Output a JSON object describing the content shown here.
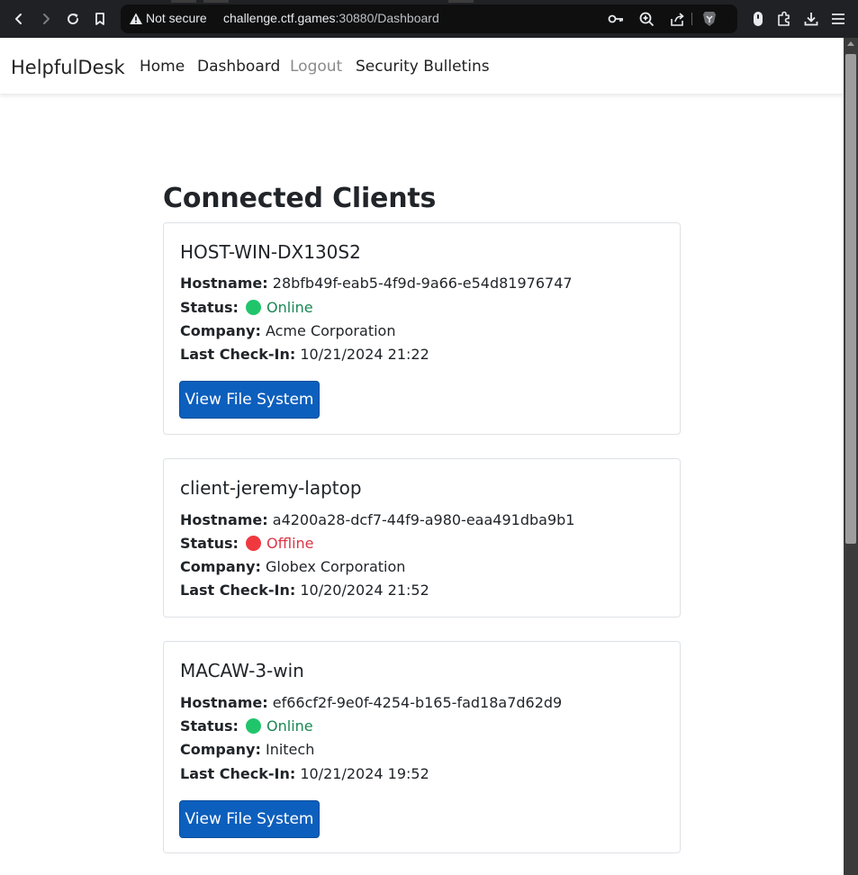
{
  "browser": {
    "security_label": "Not secure",
    "url_host": "challenge.ctf.games",
    "url_rest": ":30880/Dashboard"
  },
  "navbar": {
    "brand": "HelpfulDesk",
    "links": [
      "Home",
      "Dashboard",
      "Logout",
      "Security Bulletins"
    ]
  },
  "page": {
    "title": "Connected Clients"
  },
  "labels": {
    "hostname": "Hostname:",
    "status": "Status:",
    "company": "Company:",
    "last_checkin": "Last Check-In:",
    "view_button": "View File System"
  },
  "colors": {
    "online": "#20c56b",
    "offline": "#f0393f",
    "button": "#0d5fbd"
  },
  "clients": [
    {
      "name": "HOST-WIN-DX130S2",
      "hostname": "28bfb49f-eab5-4f9d-9a66-e54d81976747",
      "status": "Online",
      "company": "Acme Corporation",
      "last_checkin": "10/21/2024 21:22"
    },
    {
      "name": "client-jeremy-laptop",
      "hostname": "a4200a28-dcf7-44f9-a980-eaa491dba9b1",
      "status": "Offline",
      "company": "Globex Corporation",
      "last_checkin": "10/20/2024 21:52"
    },
    {
      "name": "MACAW-3-win",
      "hostname": "ef66cf2f-9e0f-4254-b165-fad18a7d62d9",
      "status": "Online",
      "company": "Initech",
      "last_checkin": "10/21/2024 19:52"
    }
  ]
}
